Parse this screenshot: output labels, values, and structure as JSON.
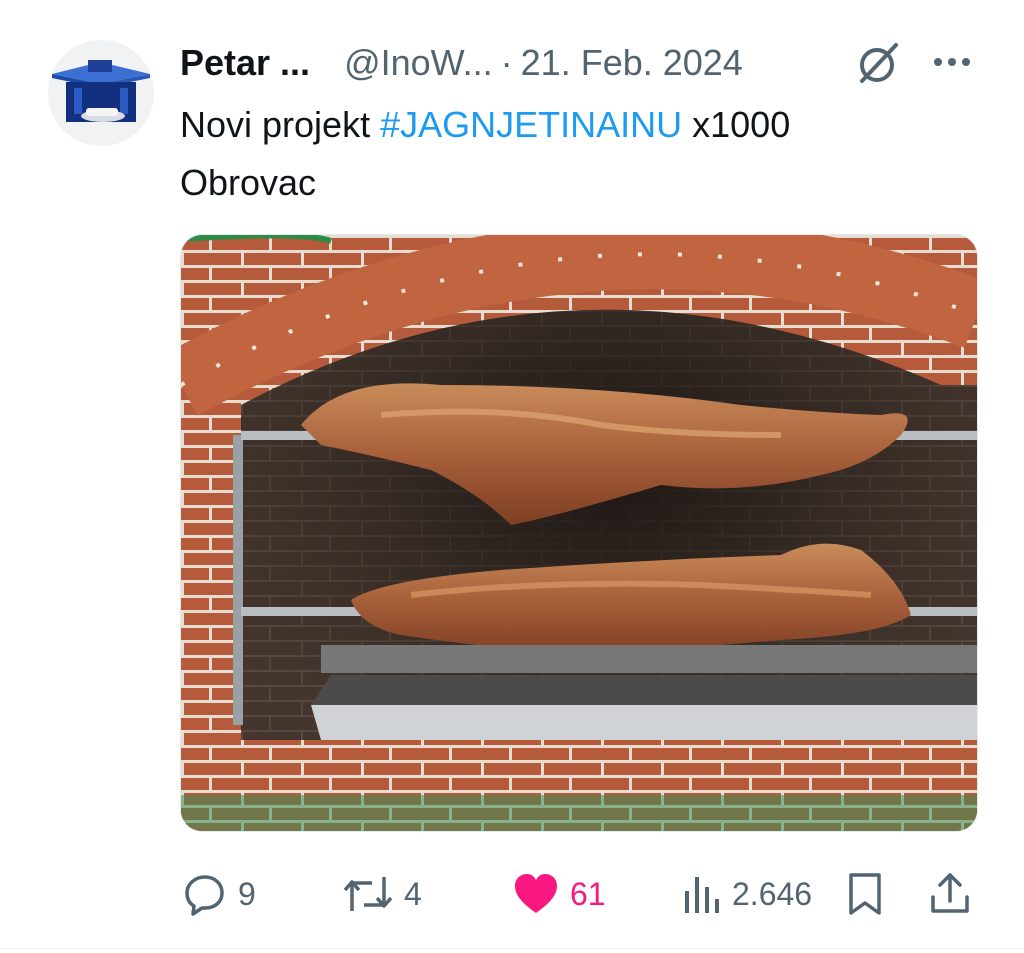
{
  "author": {
    "display_name": "Petar ...",
    "handle": "@InoW...",
    "separator": "·",
    "date": "21. Feb. 2024",
    "avatar_icon": "gas-station-logo-icon"
  },
  "tweet": {
    "text_before": "Novi projekt ",
    "hashtag": "#JAGNJETINAINU",
    "text_after": " x1000",
    "line2": "Obrovac"
  },
  "media": {
    "kind": "photo",
    "alt": ""
  },
  "actions": {
    "replies": "9",
    "retweets": "4",
    "likes": "61",
    "views": "2.646"
  },
  "colors": {
    "link": "#1d9bf0",
    "like": "#f91880",
    "secondary_text": "#536471"
  }
}
